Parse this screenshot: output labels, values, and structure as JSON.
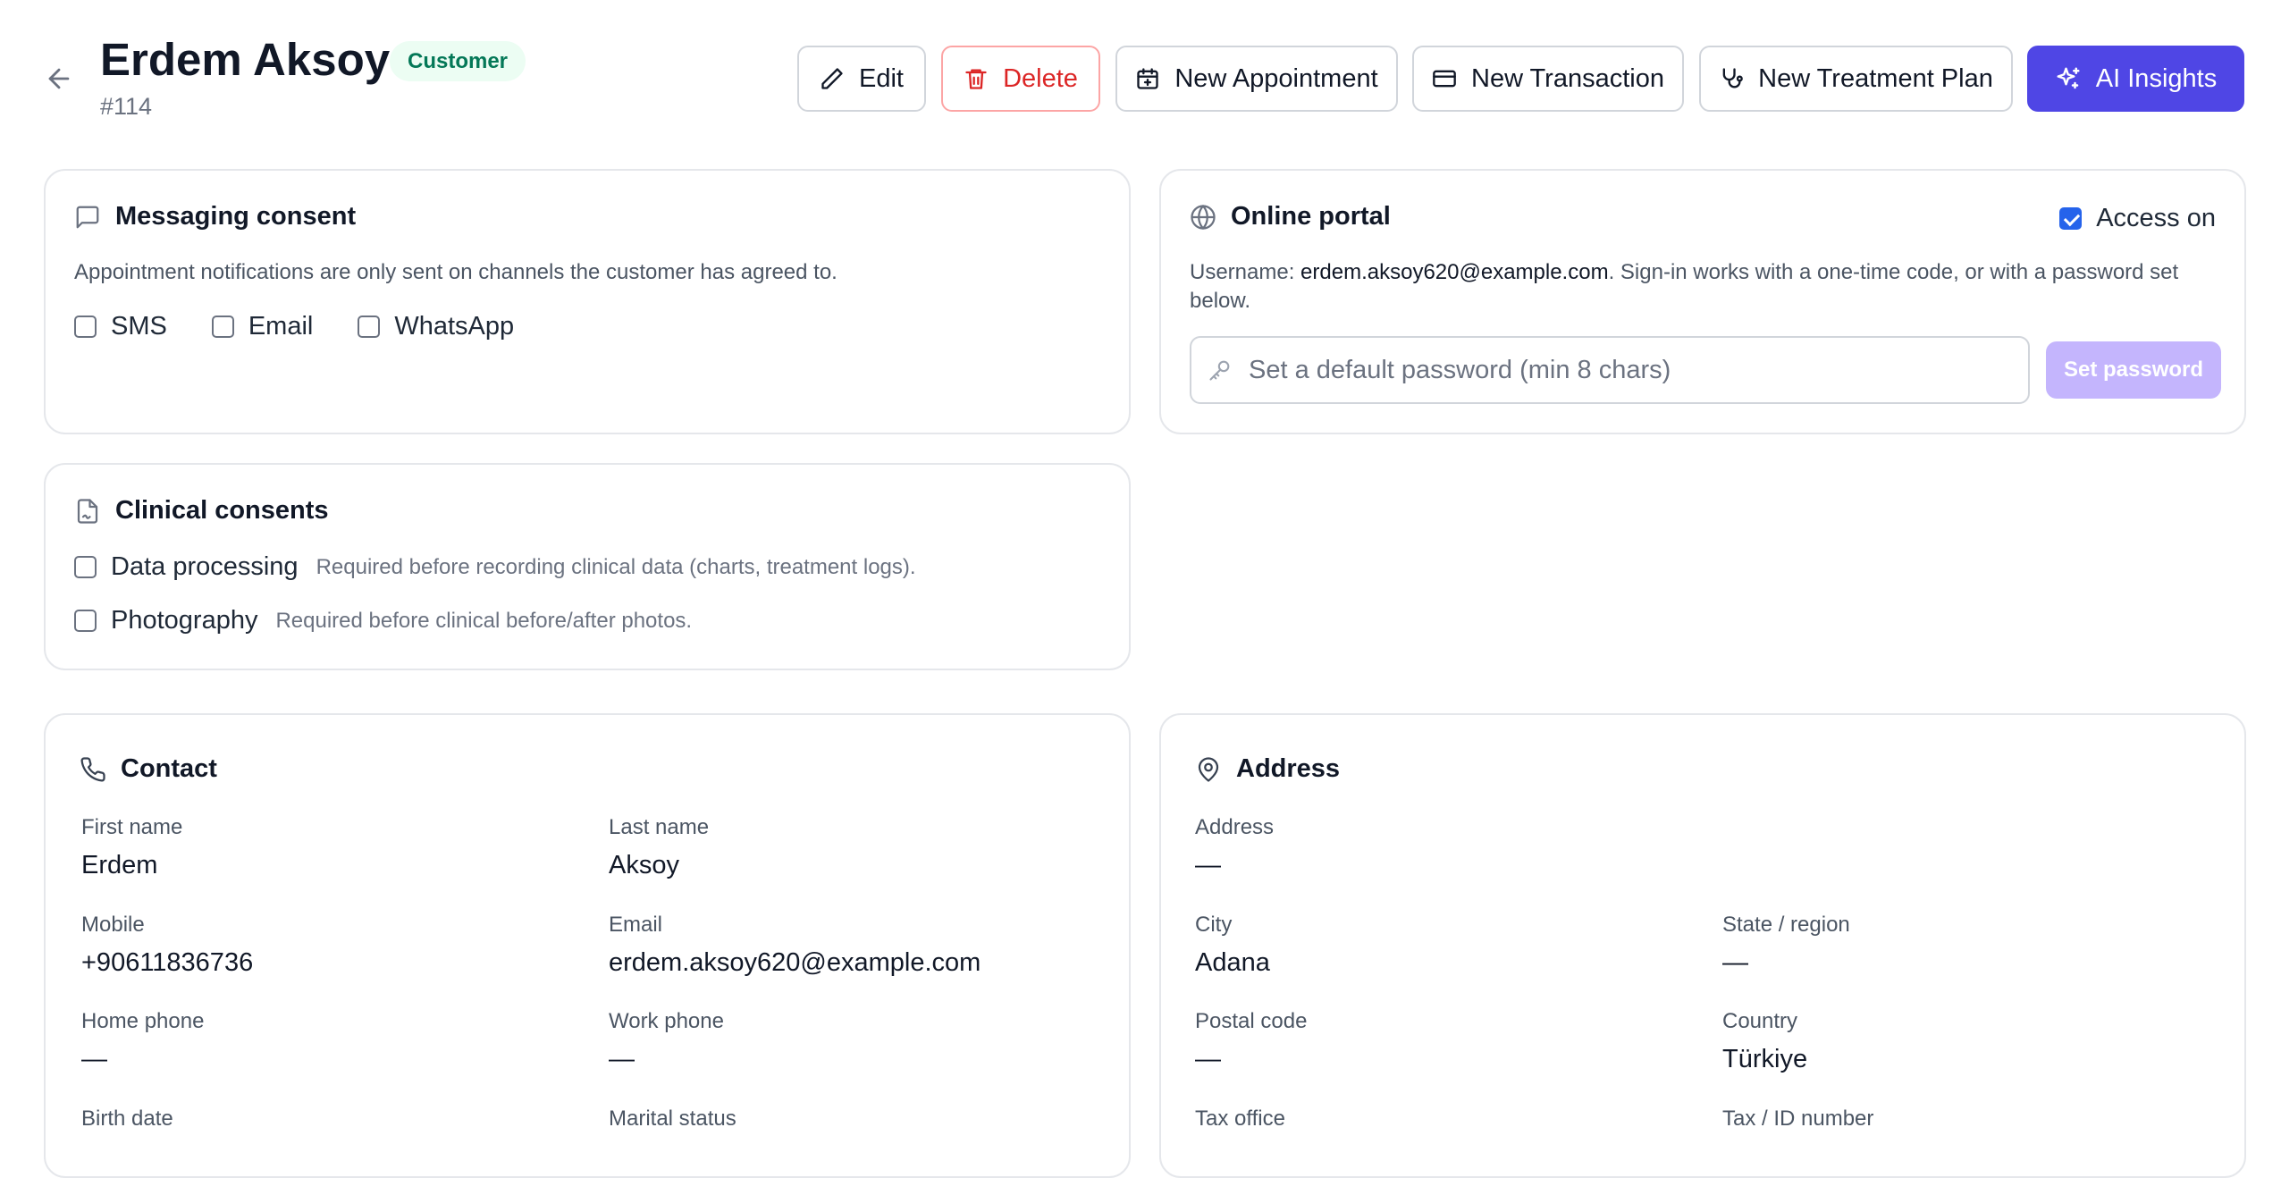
{
  "header": {
    "name": "Erdem Aksoy",
    "badge": "Customer",
    "number": "#114",
    "actions": {
      "edit": "Edit",
      "delete": "Delete",
      "new_appointment": "New Appointment",
      "new_transaction": "New Transaction",
      "new_treatment_plan": "New Treatment Plan",
      "ai_insights": "AI Insights"
    }
  },
  "messaging": {
    "title": "Messaging consent",
    "description": "Appointment notifications are only sent on channels the customer has agreed to.",
    "channels": [
      {
        "label": "SMS",
        "checked": false
      },
      {
        "label": "Email",
        "checked": false
      },
      {
        "label": "WhatsApp",
        "checked": false
      }
    ]
  },
  "portal": {
    "title": "Online portal",
    "access_label": "Access on",
    "access_checked": true,
    "username_prefix": "Username: ",
    "username": "erdem.aksoy620@example.com",
    "username_suffix": ". Sign-in works with a one-time code, or with a password set below.",
    "password_placeholder": "Set a default password (min 8 chars)",
    "password_value": "",
    "set_password_label": "Set password"
  },
  "clinical": {
    "title": "Clinical consents",
    "items": [
      {
        "label": "Data processing",
        "hint": "Required before recording clinical data (charts, treatment logs).",
        "checked": false
      },
      {
        "label": "Photography",
        "hint": "Required before clinical before/after photos.",
        "checked": false
      }
    ]
  },
  "contact": {
    "title": "Contact",
    "fields": {
      "first_name": {
        "label": "First name",
        "value": "Erdem"
      },
      "last_name": {
        "label": "Last name",
        "value": "Aksoy"
      },
      "mobile": {
        "label": "Mobile",
        "value": "+90611836736"
      },
      "email": {
        "label": "Email",
        "value": "erdem.aksoy620@example.com"
      },
      "home_phone": {
        "label": "Home phone",
        "value": "—"
      },
      "work_phone": {
        "label": "Work phone",
        "value": "—"
      },
      "birth_date": {
        "label": "Birth date",
        "value": ""
      },
      "marital_status": {
        "label": "Marital status",
        "value": ""
      }
    }
  },
  "address": {
    "title": "Address",
    "fields": {
      "address": {
        "label": "Address",
        "value": "—"
      },
      "city": {
        "label": "City",
        "value": "Adana"
      },
      "state": {
        "label": "State / region",
        "value": "—"
      },
      "postal_code": {
        "label": "Postal code",
        "value": "—"
      },
      "country": {
        "label": "Country",
        "value": "Türkiye"
      },
      "tax_office": {
        "label": "Tax office",
        "value": ""
      },
      "tax_id": {
        "label": "Tax / ID number",
        "value": ""
      }
    }
  },
  "colors": {
    "primary": "#4f46e5",
    "danger": "#dc2626",
    "badge_bg": "#ecfdf3",
    "badge_text": "#047857",
    "checkbox_checked": "#2563eb"
  }
}
